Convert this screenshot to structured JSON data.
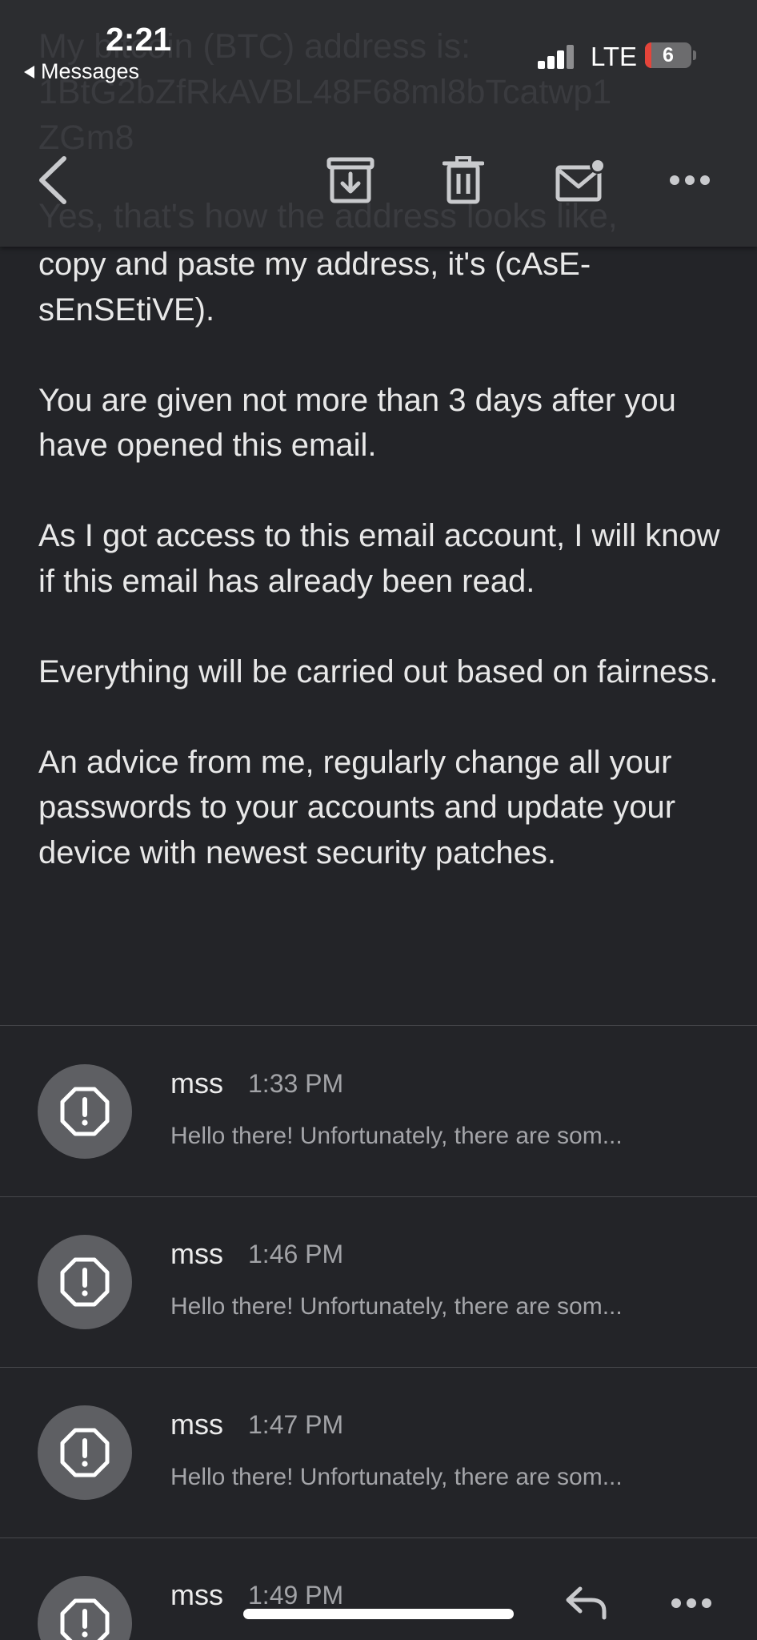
{
  "status_bar": {
    "time": "2:21",
    "back_app": "Messages",
    "network": "LTE",
    "battery": "6"
  },
  "header_ghost": {
    "top_text": "My bitcoin (BTC) address is:\n1BtG2bZfRkAVBL48F68ml8bTcatwp1\nZGm8",
    "bottom_text": "Yes, that's how the address looks like,"
  },
  "toolbar": {
    "back_icon": "chevron-left-icon",
    "archive_icon": "archive-icon",
    "trash_icon": "trash-icon",
    "mark_unread_icon": "mail-unread-icon",
    "more_icon": "more-icon"
  },
  "email": {
    "paragraphs": [
      "copy and paste my address, it's (cAsE-sEnSEtiVE).",
      "You are given not more than 3 days after you have opened this email.",
      "As I got access to this email account, I will know if this email has already been read.",
      "Everything will be carried out based on fairness.",
      "An advice from me, regularly change all your passwords to your accounts and update your device with newest security patches."
    ]
  },
  "thread": [
    {
      "sender": "mss",
      "time": "1:33 PM",
      "snippet": "Hello there! Unfortunately, there are som..."
    },
    {
      "sender": "mss",
      "time": "1:46 PM",
      "snippet": "Hello there! Unfortunately, there are som..."
    },
    {
      "sender": "mss",
      "time": "1:47 PM",
      "snippet": "Hello there! Unfortunately, there are som..."
    },
    {
      "sender": "mss",
      "time": "1:49 PM",
      "snippet": ""
    }
  ],
  "colors": {
    "background": "#232428",
    "header": "#2c2d30",
    "avatar": "#5e5f63",
    "battery_low": "#e5443a"
  }
}
